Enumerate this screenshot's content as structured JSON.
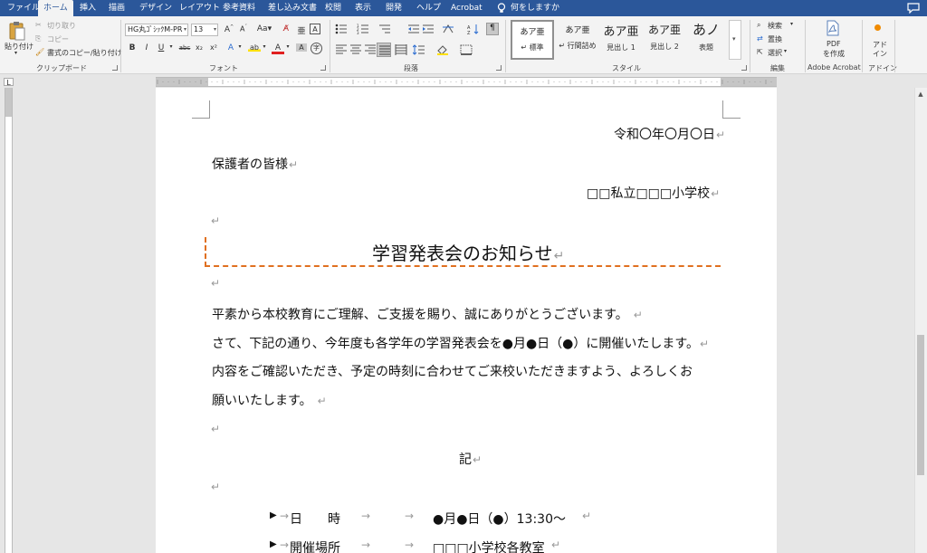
{
  "menu": {
    "tabs": [
      "ファイル",
      "ホーム",
      "挿入",
      "描画",
      "デザイン",
      "レイアウト",
      "参考資料",
      "差し込み文書",
      "校閲",
      "表示",
      "開発",
      "ヘルプ",
      "Acrobat"
    ],
    "tell_me": "何をしますか"
  },
  "ribbon": {
    "clipboard": {
      "paste": "貼り付け",
      "cut": "切り取り",
      "copy": "コピー",
      "format_painter": "書式のコピー/貼り付け",
      "label": "クリップボード"
    },
    "font": {
      "name": "HG丸ｺﾞｼｯｸM-PR",
      "size": "13",
      "label": "フォント"
    },
    "paragraph": {
      "label": "段落"
    },
    "styles": {
      "items": [
        {
          "preview": "あア亜",
          "name": "↵ 標準"
        },
        {
          "preview": "あア亜",
          "name": "↵ 行間詰め"
        },
        {
          "preview": "あア亜",
          "name": "見出し 1"
        },
        {
          "preview": "あア亜",
          "name": "見出し 2"
        },
        {
          "preview": "あノ",
          "name": "表題"
        }
      ],
      "label": "スタイル"
    },
    "editing": {
      "search": "検索",
      "replace": "置換",
      "select": "選択",
      "label": "編集"
    },
    "acrobat": {
      "create_pdf_line1": "PDF",
      "create_pdf_line2": "を作成",
      "label": "Adobe Acrobat"
    },
    "addins": {
      "btn_line1": "アド",
      "btn_line2": "イン",
      "label": "アドイン"
    }
  },
  "ruler": {
    "corner": "L"
  },
  "document": {
    "date": "令和〇年〇月〇日",
    "recipient": "保護者の皆様",
    "sender": "□□私立□□□小学校",
    "title": "学習発表会のお知らせ",
    "body": [
      "平素から本校教育にご理解、ご支援を賜り、誠にありがとうございます。",
      "さて、下記の通り、今年度も各学年の学習発表会を●月●日（●）に開催いたします。",
      "内容をご確認いただき、予定の時刻に合わせてご来校いただきますよう、よろしくお",
      "願いいたします。"
    ],
    "ki": "記",
    "details": [
      {
        "label": "日　　時",
        "value": "●月●日（●）13:30〜"
      },
      {
        "label": "開催場所",
        "value": "□□□小学校各教室"
      }
    ],
    "para_mark": "↵",
    "tab_mark": "→"
  },
  "colors": {
    "ribbon_blue": "#2b579a",
    "title_frame": "#e07020"
  }
}
